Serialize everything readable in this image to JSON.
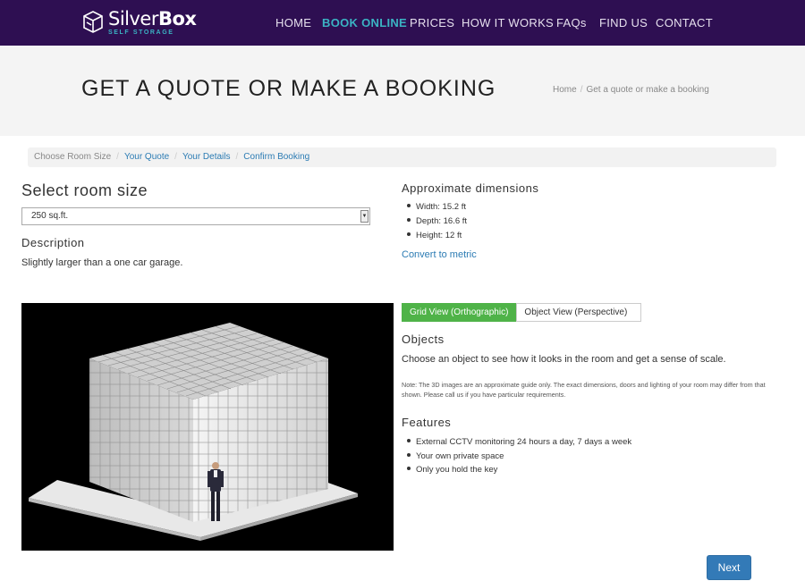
{
  "brand": {
    "name_light": "Silver",
    "name_bold": "Box",
    "tagline": "SELF STORAGE"
  },
  "nav": {
    "items": [
      {
        "label": "HOME"
      },
      {
        "label": "BOOK ONLINE",
        "active": true
      },
      {
        "label": "PRICES"
      },
      {
        "label": "HOW IT WORKS"
      },
      {
        "label": "FAQs"
      },
      {
        "label": "FIND US"
      },
      {
        "label": "CONTACT"
      }
    ]
  },
  "header": {
    "title": "GET A QUOTE OR MAKE A BOOKING",
    "breadcrumb": [
      "Home",
      "Get a quote or make a booking"
    ]
  },
  "steps": [
    {
      "label": "Choose Room Size",
      "state": "current"
    },
    {
      "label": "Your Quote",
      "state": "link"
    },
    {
      "label": "Your Details",
      "state": "link"
    },
    {
      "label": "Confirm Booking",
      "state": "link"
    }
  ],
  "room": {
    "heading": "Select room size",
    "selected_size": "250 sq.ft.",
    "description_heading": "Description",
    "description": "Slightly larger than a one car garage."
  },
  "dimensions": {
    "heading": "Approximate dimensions",
    "items": [
      "Width: 15.2 ft",
      "Depth: 16.6 ft",
      "Height: 12 ft"
    ],
    "convert_link": "Convert to metric"
  },
  "view_tabs": {
    "grid": "Grid View (Orthographic)",
    "object": "Object View (Perspective)"
  },
  "objects": {
    "heading": "Objects",
    "text": "Choose an object to see how it looks in the room and get a sense of scale.",
    "note": "Note: The 3D images are an approximate guide only. The exact dimensions, doors and lighting of your room may differ from that shown. Please call us if you have particular requirements."
  },
  "features": {
    "heading": "Features",
    "items": [
      "External CCTV monitoring 24 hours a day, 7 days a week",
      "Your own private space",
      "Only you hold the key"
    ]
  },
  "actions": {
    "next_label": "Next"
  },
  "colors": {
    "topbar": "#2e0f52",
    "accent": "#3bb3c3",
    "link": "#2b7bb3",
    "tab_active": "#4fb348",
    "button": "#337ab7"
  },
  "icons": {
    "logo": "box-icon",
    "select_arrow": "chevron-down-icon"
  }
}
